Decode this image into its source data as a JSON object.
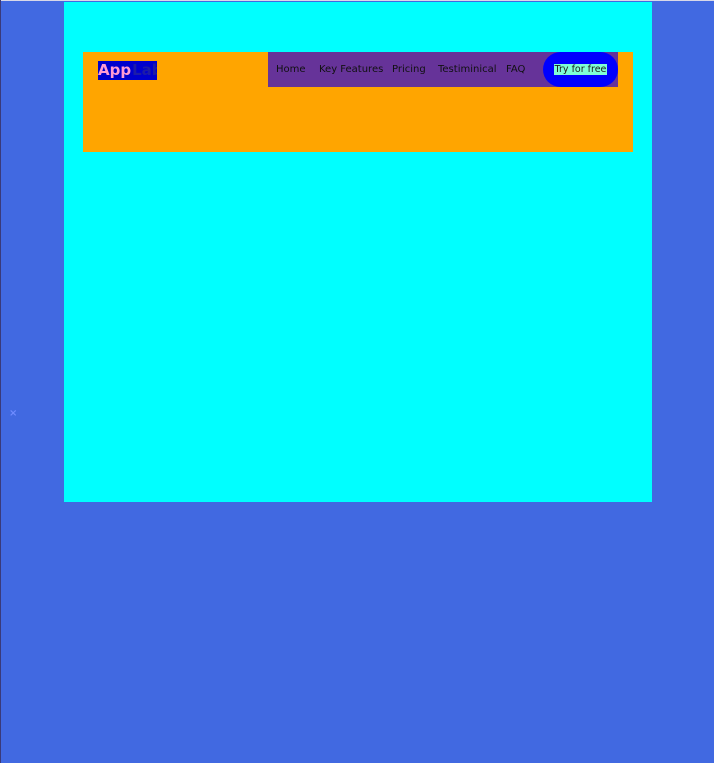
{
  "colors": {
    "page_background": "#4169e1",
    "container_background": "#00ffff",
    "header_background": "#ffa500",
    "nav_background": "#663399",
    "logo_background": "#0000cd",
    "cta_background": "#0000ff",
    "cta_label_highlight": "#7fffd4"
  },
  "stray_mark": "×",
  "header": {
    "logo": {
      "part1": "App",
      "part2": "Lab"
    },
    "nav": {
      "items": [
        {
          "label": "Home"
        },
        {
          "label": "Key Features"
        },
        {
          "label": "Pricing"
        },
        {
          "label": "Testiminical"
        },
        {
          "label": "FAQ"
        }
      ],
      "cta_label": "Try for free"
    }
  }
}
